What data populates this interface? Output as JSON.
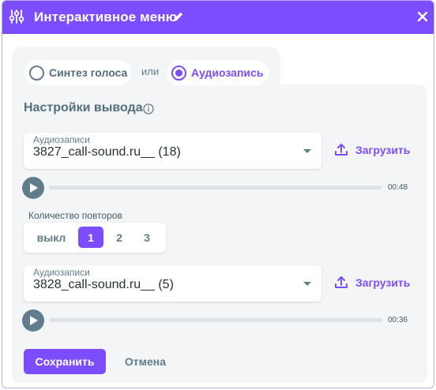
{
  "window": {
    "title": "Интерактивное меню",
    "title_icon": "sliders-icon",
    "edit_icon": "pencil-icon",
    "close_icon": "close-icon"
  },
  "mode": {
    "option_tts": "Синтез голоса",
    "separator": "или",
    "option_audio": "Аудиозапись",
    "selected": "Аудиозапись"
  },
  "output": {
    "title": "Настройки вывода",
    "info_icon": "info-icon",
    "first": {
      "label": "Аудиозаписи",
      "value": "3827_call-sound.ru__ (18)",
      "upload_label": "Загрузить",
      "duration": "00:48"
    },
    "repeat": {
      "label": "Количество повторов",
      "options": [
        "выкл",
        "1",
        "2",
        "3"
      ],
      "selected": "1"
    },
    "second": {
      "label": "Аудиозаписи",
      "value": "3828_call-sound.ru__ (5)",
      "upload_label": "Загрузить",
      "duration": "00:36"
    }
  },
  "actions": {
    "save": "Сохранить",
    "cancel": "Отмена"
  },
  "colors": {
    "accent": "#7c4dff",
    "muted": "#607d8b",
    "panel": "#f3f5f7"
  }
}
